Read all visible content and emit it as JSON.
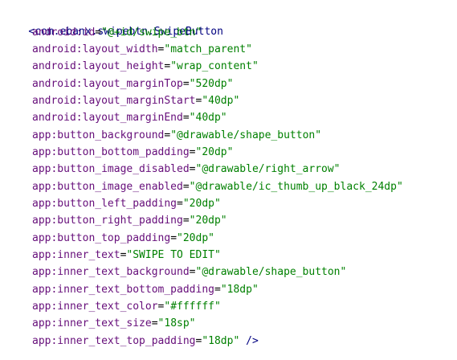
{
  "colors": {
    "background": "#ffffff",
    "tag": "#000080",
    "attribute": "#660e7a",
    "value": "#008000",
    "equals": "#000000"
  },
  "code": {
    "open_tag": "<com.ebanx.swipebtn.SwipeButton",
    "close_tag": " />",
    "attributes": [
      {
        "name": "android:id",
        "value": "\"@+id/swipe_btn\""
      },
      {
        "name": "android:layout_width",
        "value": "\"match_parent\""
      },
      {
        "name": "android:layout_height",
        "value": "\"wrap_content\""
      },
      {
        "name": "android:layout_marginTop",
        "value": "\"520dp\""
      },
      {
        "name": "android:layout_marginStart",
        "value": "\"40dp\""
      },
      {
        "name": "android:layout_marginEnd",
        "value": "\"40dp\""
      },
      {
        "name": "app:button_background",
        "value": "\"@drawable/shape_button\""
      },
      {
        "name": "app:button_bottom_padding",
        "value": "\"20dp\""
      },
      {
        "name": "app:button_image_disabled",
        "value": "\"@drawable/right_arrow\""
      },
      {
        "name": "app:button_image_enabled",
        "value": "\"@drawable/ic_thumb_up_black_24dp\""
      },
      {
        "name": "app:button_left_padding",
        "value": "\"20dp\""
      },
      {
        "name": "app:button_right_padding",
        "value": "\"20dp\""
      },
      {
        "name": "app:button_top_padding",
        "value": "\"20dp\""
      },
      {
        "name": "app:inner_text",
        "value": "\"SWIPE TO EDIT\""
      },
      {
        "name": "app:inner_text_background",
        "value": "\"@drawable/shape_button\""
      },
      {
        "name": "app:inner_text_bottom_padding",
        "value": "\"18dp\""
      },
      {
        "name": "app:inner_text_color",
        "value": "\"#ffffff\""
      },
      {
        "name": "app:inner_text_size",
        "value": "\"18sp\""
      },
      {
        "name": "app:inner_text_top_padding",
        "value": "\"18dp\""
      }
    ]
  }
}
